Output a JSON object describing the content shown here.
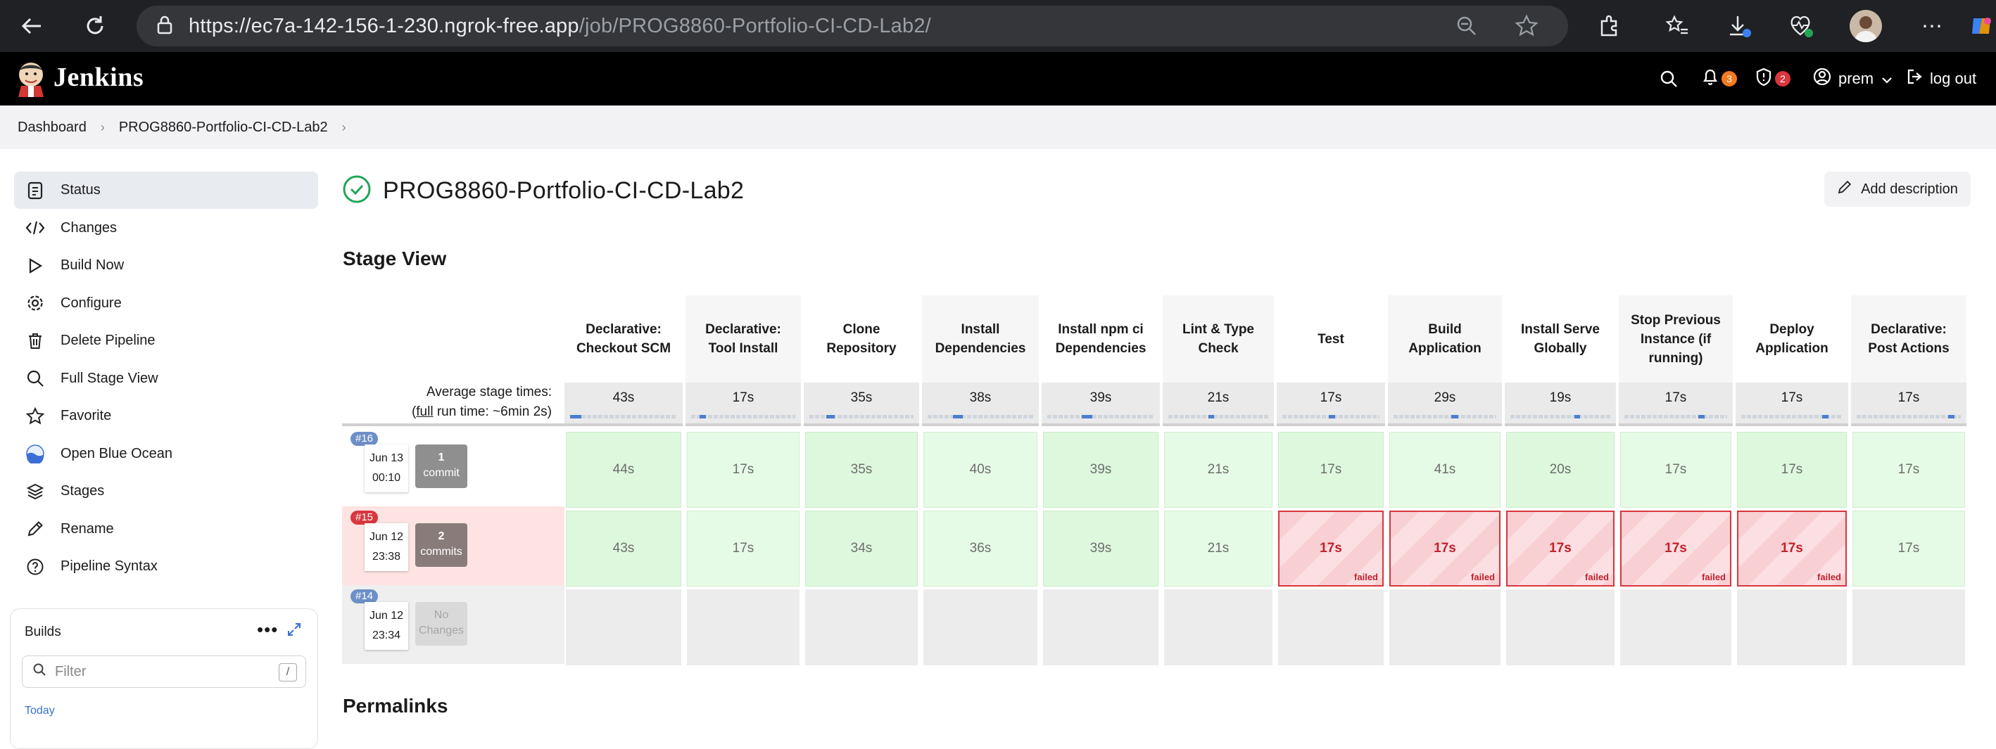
{
  "browser": {
    "url_host": "https://ec7a-142-156-1-230.ngrok-free.app",
    "url_path": "/job/PROG8860-Portfolio-CI-CD-Lab2/"
  },
  "header": {
    "app_name": "Jenkins",
    "notifications_count": "3",
    "security_count": "2",
    "user": "prem",
    "logout": "log out",
    "colors": {
      "notifications": "#f47a20",
      "security": "#d9363e"
    }
  },
  "breadcrumb": [
    "Dashboard",
    "PROG8860-Portfolio-CI-CD-Lab2"
  ],
  "sidebar": {
    "items": [
      {
        "label": "Status",
        "icon": "document-icon"
      },
      {
        "label": "Changes",
        "icon": "code-icon"
      },
      {
        "label": "Build Now",
        "icon": "play-icon"
      },
      {
        "label": "Configure",
        "icon": "gear-icon"
      },
      {
        "label": "Delete Pipeline",
        "icon": "trash-icon"
      },
      {
        "label": "Full Stage View",
        "icon": "search-icon"
      },
      {
        "label": "Favorite",
        "icon": "star-icon"
      },
      {
        "label": "Open Blue Ocean",
        "icon": "blue-ocean-icon"
      },
      {
        "label": "Stages",
        "icon": "layers-icon"
      },
      {
        "label": "Rename",
        "icon": "pencil-icon"
      },
      {
        "label": "Pipeline Syntax",
        "icon": "help-icon"
      }
    ]
  },
  "builds": {
    "title": "Builds",
    "filter_placeholder": "Filter",
    "filter_shortcut": "/",
    "group": "Today"
  },
  "main": {
    "title": "PROG8860-Portfolio-CI-CD-Lab2",
    "add_description": "Add description",
    "stage_view_heading": "Stage View",
    "permalinks_heading": "Permalinks"
  },
  "stage_view": {
    "avg_label": "Average stage times:",
    "full_run_prefix": "(",
    "full_run_link": "full",
    "full_run_suffix": " run time: ~6min 2s)",
    "stages": [
      {
        "name": "Declarative: Checkout SCM",
        "avg": "43s",
        "avg_fraction": 0.15
      },
      {
        "name": "Declarative: Tool Install",
        "avg": "17s",
        "avg_fraction": 0.06
      },
      {
        "name": "Clone Repository",
        "avg": "35s",
        "avg_fraction": 0.12
      },
      {
        "name": "Install Dependencies",
        "avg": "38s",
        "avg_fraction": 0.13
      },
      {
        "name": "Install npm ci Dependencies",
        "avg": "39s",
        "avg_fraction": 0.14
      },
      {
        "name": "Lint & Type Check",
        "avg": "21s",
        "avg_fraction": 0.07
      },
      {
        "name": "Test",
        "avg": "17s",
        "avg_fraction": 0.06
      },
      {
        "name": "Build Application",
        "avg": "29s",
        "avg_fraction": 0.1
      },
      {
        "name": "Install Serve Globally",
        "avg": "19s",
        "avg_fraction": 0.07
      },
      {
        "name": "Stop Previous Instance (if running)",
        "avg": "17s",
        "avg_fraction": 0.06
      },
      {
        "name": "Deploy Application",
        "avg": "17s",
        "avg_fraction": 0.06
      },
      {
        "name": "Declarative: Post Actions",
        "avg": "17s",
        "avg_fraction": 0.06
      }
    ],
    "runs": [
      {
        "number": "#16",
        "date": "Jun 13",
        "time": "00:10",
        "commits_count": "1",
        "commits_label": "commit",
        "status": "success",
        "cells": [
          [
            "44s",
            "ok"
          ],
          [
            "17s",
            "ok"
          ],
          [
            "35s",
            "ok"
          ],
          [
            "40s",
            "ok"
          ],
          [
            "39s",
            "ok"
          ],
          [
            "21s",
            "ok"
          ],
          [
            "17s",
            "ok"
          ],
          [
            "41s",
            "ok"
          ],
          [
            "20s",
            "ok"
          ],
          [
            "17s",
            "ok"
          ],
          [
            "17s",
            "ok"
          ],
          [
            "17s",
            "ok"
          ]
        ]
      },
      {
        "number": "#15",
        "date": "Jun 12",
        "time": "23:38",
        "commits_count": "2",
        "commits_label": "commits",
        "status": "failed",
        "cells": [
          [
            "43s",
            "ok"
          ],
          [
            "17s",
            "ok"
          ],
          [
            "34s",
            "ok"
          ],
          [
            "36s",
            "ok"
          ],
          [
            "39s",
            "ok"
          ],
          [
            "21s",
            "ok"
          ],
          [
            "17s",
            "fail"
          ],
          [
            "17s",
            "fail"
          ],
          [
            "17s",
            "fail"
          ],
          [
            "17s",
            "fail"
          ],
          [
            "17s",
            "fail"
          ],
          [
            "17s",
            "ok"
          ]
        ]
      },
      {
        "number": "#14",
        "date": "Jun 12",
        "time": "23:34",
        "commits_count": "No",
        "commits_label": "Changes",
        "status": "aborted",
        "cells": [
          [
            "",
            "empty"
          ],
          [
            "",
            "empty"
          ],
          [
            "",
            "empty"
          ],
          [
            "",
            "empty"
          ],
          [
            "",
            "empty"
          ],
          [
            "",
            "empty"
          ],
          [
            "",
            "empty"
          ],
          [
            "",
            "empty"
          ],
          [
            "",
            "empty"
          ],
          [
            "",
            "empty"
          ],
          [
            "",
            "empty"
          ],
          [
            "",
            "empty"
          ]
        ]
      }
    ],
    "failed_label": "failed"
  }
}
